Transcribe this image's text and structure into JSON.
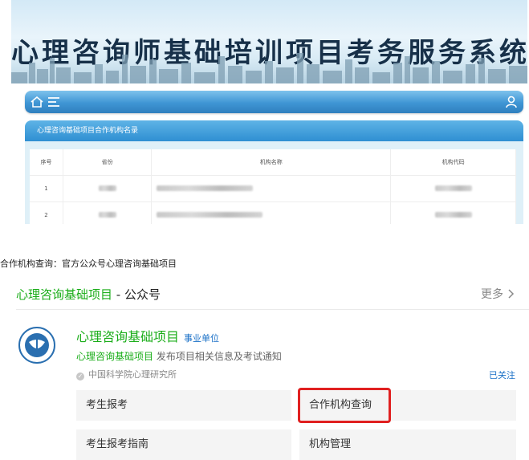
{
  "portal": {
    "banner_title": "心理咨询师基础培训项目考务服务系统",
    "panel_title": "心理咨询基础项目合作机构名录",
    "table": {
      "headers": [
        "序号",
        "省份",
        "机构名称",
        "机构代码"
      ],
      "rows": [
        {
          "index": "1"
        },
        {
          "index": "2"
        }
      ]
    }
  },
  "caption": {
    "label": "合作机构查询：",
    "text": "官方公众号心理咨询基础项目"
  },
  "card": {
    "title_green": "心理咨询基础项目",
    "title_rest": " - 公众号",
    "more": "更多",
    "account": {
      "name": "心理咨询基础项目",
      "tag": "事业单位",
      "desc_highlight": "心理咨询基础项目",
      "desc_rest": " 发布项目相关信息及考试通知",
      "verify": "中国科学院心理研究所",
      "followed": "已关注"
    },
    "menu": [
      "考生报考",
      "合作机构查询",
      "考生报考指南",
      "机构管理"
    ]
  },
  "colors": {
    "green": "#1aad19",
    "link_blue": "#1a70c7",
    "nav_blue": "#3f95d4",
    "highlight_red": "#e02020"
  }
}
